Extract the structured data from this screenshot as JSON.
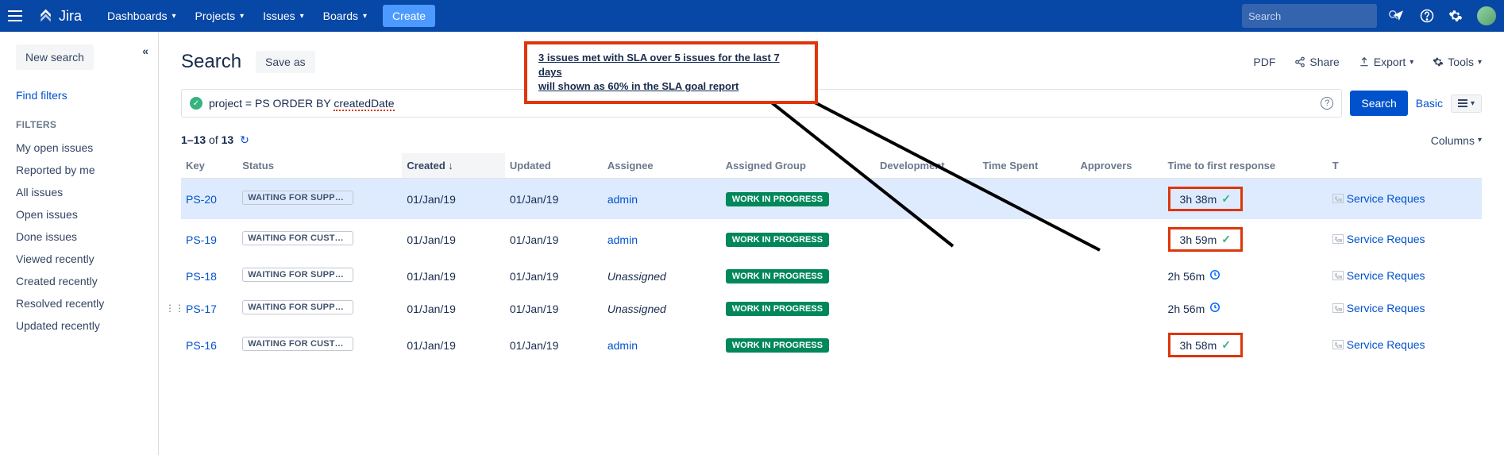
{
  "topnav": {
    "logo_text": "Jira",
    "items": [
      "Dashboards",
      "Projects",
      "Issues",
      "Boards"
    ],
    "create_label": "Create",
    "search_placeholder": "Search"
  },
  "sidebar": {
    "new_search": "New search",
    "find_filters": "Find filters",
    "filters_header": "FILTERS",
    "filters": [
      "My open issues",
      "Reported by me",
      "All issues",
      "Open issues",
      "Done issues",
      "Viewed recently",
      "Created recently",
      "Resolved recently",
      "Updated recently"
    ]
  },
  "page": {
    "title": "Search",
    "save_as": "Save as",
    "actions": {
      "pdf": "PDF",
      "share": "Share",
      "export": "Export",
      "tools": "Tools"
    }
  },
  "jql": {
    "prefix": "project = PS ORDER BY  ",
    "suffix": "createdDate",
    "search_btn": "Search",
    "basic": "Basic"
  },
  "results": {
    "count_prefix": "1–13",
    "count_mid": " of ",
    "count_total": "13",
    "columns_label": "Columns"
  },
  "columns": {
    "key": "Key",
    "status": "Status",
    "created": "Created",
    "updated": "Updated",
    "assignee": "Assignee",
    "assigned_group": "Assigned Group",
    "development": "Development",
    "time_spent": "Time Spent",
    "approvers": "Approvers",
    "ttfr": "Time to first response",
    "t": "T"
  },
  "rows": [
    {
      "key": "PS-20",
      "status": "WAITING FOR SUPPORT",
      "created": "01/Jan/19",
      "updated": "01/Jan/19",
      "assignee": "admin",
      "assignee_link": true,
      "group": "WORK IN PROGRESS",
      "ttfr": "3h 38m",
      "sla_ok": true,
      "sla_boxed": true,
      "type": "Service Reques",
      "highlight": true
    },
    {
      "key": "PS-19",
      "status": "WAITING FOR CUSTOM...",
      "created": "01/Jan/19",
      "updated": "01/Jan/19",
      "assignee": "admin",
      "assignee_link": true,
      "group": "WORK IN PROGRESS",
      "ttfr": "3h 59m",
      "sla_ok": true,
      "sla_boxed": true,
      "type": "Service Reques"
    },
    {
      "key": "PS-18",
      "status": "WAITING FOR SUPPORT",
      "created": "01/Jan/19",
      "updated": "01/Jan/19",
      "assignee": "Unassigned",
      "assignee_link": false,
      "group": "WORK IN PROGRESS",
      "ttfr": "2h 56m",
      "sla_ok": false,
      "sla_boxed": false,
      "type": "Service Reques"
    },
    {
      "key": "PS-17",
      "status": "WAITING FOR SUPPORT",
      "created": "01/Jan/19",
      "updated": "01/Jan/19",
      "assignee": "Unassigned",
      "assignee_link": false,
      "group": "WORK IN PROGRESS",
      "ttfr": "2h 56m",
      "sla_ok": false,
      "sla_boxed": false,
      "type": "Service Reques",
      "show_handle": true
    },
    {
      "key": "PS-16",
      "status": "WAITING FOR CUSTOM...",
      "created": "01/Jan/19",
      "updated": "01/Jan/19",
      "assignee": "admin",
      "assignee_link": true,
      "group": "WORK IN PROGRESS",
      "ttfr": "3h 58m",
      "sla_ok": true,
      "sla_boxed": true,
      "type": "Service Reques"
    }
  ],
  "annotation": {
    "line1": "3 issues met with SLA over  5 issues for the last 7 days",
    "line2": "will shown as 60% in the SLA goal report"
  }
}
